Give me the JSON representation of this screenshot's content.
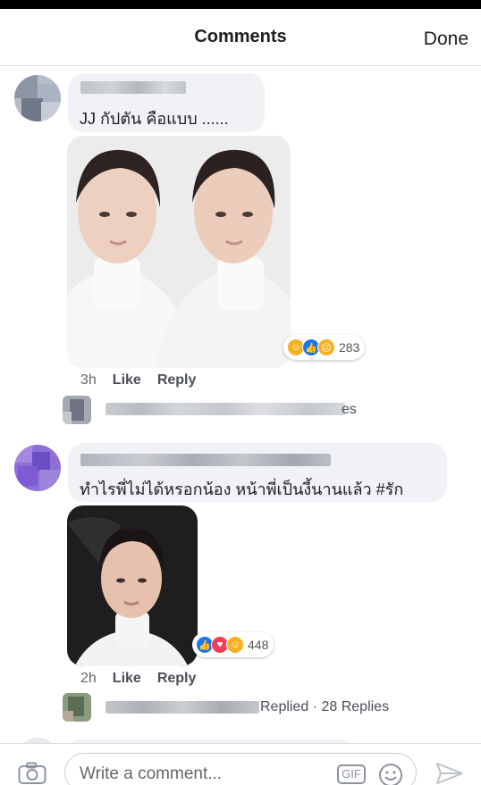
{
  "header": {
    "title": "Comments",
    "done_label": "Done"
  },
  "comments": [
    {
      "text": "JJ กัปตัน คือแบบ ......",
      "time": "3h",
      "like_label": "Like",
      "reply_label": "Reply",
      "reactions": {
        "icons": [
          "haha-icon",
          "like-icon",
          "sad-icon"
        ],
        "count": "283"
      },
      "reply_preview": {
        "text": "es"
      }
    },
    {
      "text": "ทำไรพี่ไม่ได้หรอกน้อง หน้าพี่เป็นงี้นานแล้ว #รัก",
      "time": "2h",
      "like_label": "Like",
      "reply_label": "Reply",
      "reactions": {
        "icons": [
          "like-icon",
          "love-icon",
          "haha-icon"
        ],
        "count": "448"
      },
      "reply_preview": {
        "text": "Replied · 28 Replies"
      }
    }
  ],
  "composer": {
    "placeholder": "Write a comment...",
    "gif_label": "GIF"
  },
  "colors": {
    "like": "#1877f2",
    "love": "#f33e58",
    "haha": "#f7b125",
    "bubble": "#f0f2f5"
  }
}
